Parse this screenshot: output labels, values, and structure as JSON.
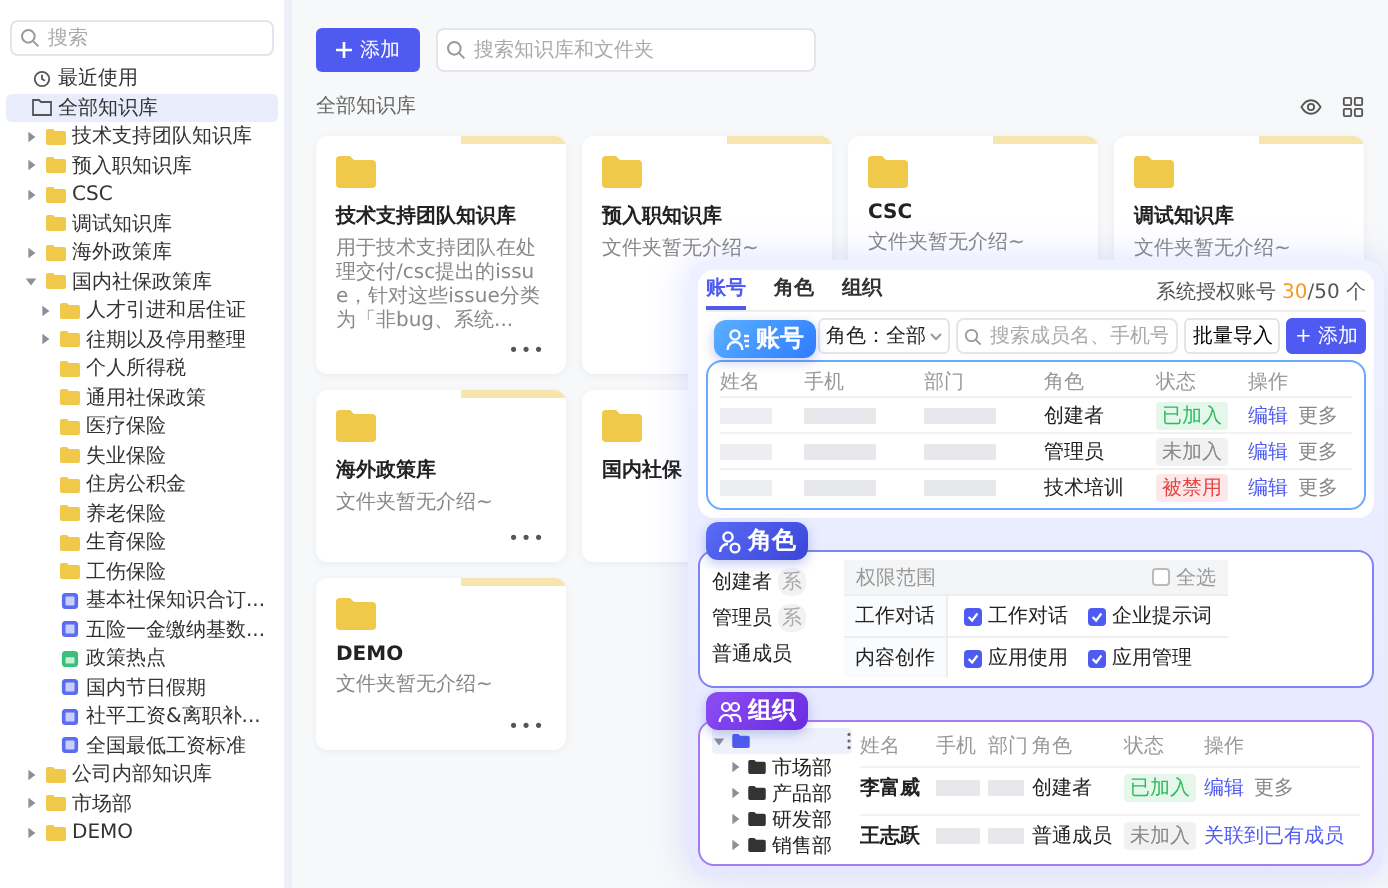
{
  "sidebar": {
    "search": {
      "placeholder": "搜索"
    },
    "items": [
      {
        "kind": "recent",
        "label": "最近使用",
        "selected": false
      },
      {
        "kind": "library",
        "label": "全部知识库",
        "selected": true,
        "children": [
          {
            "kind": "group",
            "label": "技术支持团队知识库",
            "expanded": false
          },
          {
            "kind": "group",
            "label": "预入职知识库",
            "expanded": false
          },
          {
            "kind": "group",
            "label": "CSC",
            "expanded": false
          },
          {
            "kind": "folder",
            "label": "调试知识库"
          },
          {
            "kind": "group",
            "label": "海外政策库",
            "expanded": false
          },
          {
            "kind": "group",
            "label": "国内社保政策库",
            "expanded": true,
            "children": [
              {
                "kind": "group",
                "label": "人才引进和居住证",
                "expanded": false
              },
              {
                "kind": "group",
                "label": "往期以及停用整理",
                "expanded": false
              },
              {
                "kind": "folder",
                "label": "个人所得税"
              },
              {
                "kind": "folder",
                "label": "通用社保政策"
              },
              {
                "kind": "folder",
                "label": "医疗保险"
              },
              {
                "kind": "folder",
                "label": "失业保险"
              },
              {
                "kind": "folder",
                "label": "住房公积金"
              },
              {
                "kind": "folder",
                "label": "养老保险"
              },
              {
                "kind": "folder",
                "label": "生育保险"
              },
              {
                "kind": "folder",
                "label": "工伤保险"
              },
              {
                "kind": "doc",
                "label": "基本社保知识合订..."
              },
              {
                "kind": "doc",
                "label": "五险一金缴纳基数..."
              },
              {
                "kind": "sheet",
                "label": "政策热点"
              },
              {
                "kind": "doc",
                "label": "国内节日假期"
              },
              {
                "kind": "doc",
                "label": "社平工资&离职补..."
              },
              {
                "kind": "doc",
                "label": "全国最低工资标准"
              }
            ]
          },
          {
            "kind": "group",
            "label": "公司内部知识库",
            "expanded": false
          },
          {
            "kind": "group",
            "label": "市场部",
            "expanded": false
          },
          {
            "kind": "group",
            "label": "DEMO",
            "expanded": false
          }
        ]
      }
    ]
  },
  "main": {
    "add_button": "添加",
    "search": {
      "placeholder": "搜索知识库和文件夹"
    },
    "breadcrumb": "全部知识库",
    "card_rows": [
      [
        {
          "title": "技术支持团队知识库",
          "description": "用于技术支持团队在处理交付/csc提出的issue，针对这些issue分类为「非bug、系统...",
          "more": "•••"
        },
        {
          "title": "预入职知识库",
          "description": "文件夹暂无介绍~"
        },
        {
          "title": "CSC",
          "description": "文件夹暂无介绍~"
        },
        {
          "title": "调试知识库",
          "description": "文件夹暂无介绍~"
        }
      ],
      [
        {
          "title": "海外政策库",
          "description": "文件夹暂无介绍~",
          "more": "•••"
        },
        {
          "title": "国内社保"
        }
      ],
      [
        {
          "title": "DEMO",
          "description": "文件夹暂无介绍~",
          "more": "•••"
        }
      ]
    ]
  },
  "feature_panel": {
    "accounts": {
      "tabs": [
        {
          "label": "账号",
          "selected": true
        },
        {
          "label": "角色",
          "selected": false
        },
        {
          "label": "组织",
          "selected": false
        }
      ],
      "quota": {
        "label": "系统授权账号",
        "used": "30",
        "total": "/50 个"
      },
      "badge": "账号",
      "role_filter": "角色：全部",
      "search": {
        "placeholder": "搜索成员名、手机号"
      },
      "import_button": "批量导入",
      "add_button": "+ 添加",
      "columns": [
        "姓名",
        "手机",
        "部门",
        "角色",
        "状态",
        "操作"
      ],
      "rows": [
        {
          "role": "创建者",
          "status": "已加入",
          "color": "#2dbb5d",
          "actions": [
            {
              "label": "编辑",
              "kind": "primary"
            },
            {
              "label": "更多",
              "kind": "secondary"
            }
          ]
        },
        {
          "role": "管理员",
          "status": "未加入",
          "color": "#888888",
          "actions": [
            {
              "label": "编辑",
              "kind": "primary"
            },
            {
              "label": "更多",
              "kind": "secondary"
            }
          ]
        },
        {
          "role": "技术培训",
          "status": "被禁用",
          "color": "#e54545",
          "actions": [
            {
              "label": "编辑",
              "kind": "primary"
            },
            {
              "label": "更多",
              "kind": "secondary"
            }
          ]
        }
      ]
    },
    "roles": {
      "badge": "角色",
      "roles": [
        {
          "name": "创建者",
          "tag": "系"
        },
        {
          "name": "管理员",
          "tag": "系"
        },
        {
          "name": "普通成员"
        }
      ],
      "header": "权限范围",
      "select_all": {
        "label": "全选",
        "checked": false
      },
      "groups": [
        {
          "name": "工作对话",
          "options": [
            {
              "label": "工作对话",
              "checked": true
            },
            {
              "label": "企业提示词",
              "checked": true
            }
          ]
        },
        {
          "name": "内容创作",
          "options": [
            {
              "label": "应用使用",
              "checked": true
            },
            {
              "label": "应用管理",
              "checked": true
            }
          ]
        }
      ]
    },
    "org": {
      "badge": "组织",
      "tree": {
        "expanded": true,
        "selected": true,
        "children": [
          {
            "label": "市场部",
            "expanded": false,
            "selected": false
          },
          {
            "label": "产品部",
            "expanded": false,
            "selected": false
          },
          {
            "label": "研发部",
            "expanded": false,
            "selected": false
          },
          {
            "label": "销售部",
            "expanded": false,
            "selected": false
          }
        ]
      },
      "columns": [
        "姓名",
        "手机",
        "部门",
        "角色",
        "状态",
        "操作"
      ],
      "rows": [
        {
          "name": "李富威",
          "role": "创建者",
          "status": "已加入",
          "color": "#2dbb5d",
          "actions": [
            {
              "label": "编辑",
              "kind": "primary"
            },
            {
              "label": "更多",
              "kind": "secondary"
            }
          ]
        },
        {
          "name": "王志跃",
          "role": "普通成员",
          "status": "未加入",
          "color": "#888888",
          "actions": [
            {
              "label": "关联到已有成员",
              "kind": "primary"
            }
          ]
        }
      ]
    }
  }
}
